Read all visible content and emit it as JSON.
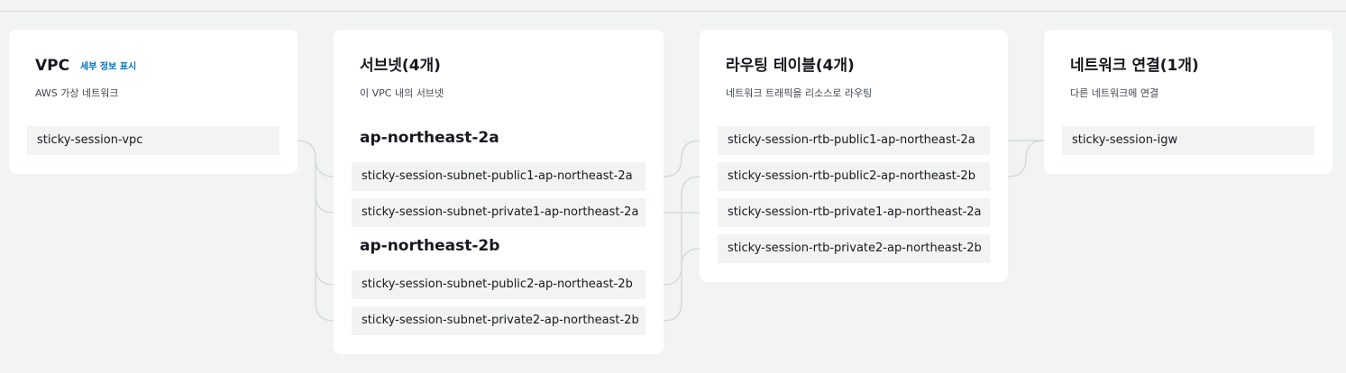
{
  "vpc": {
    "title": "VPC",
    "detail_link": "세부 정보 표시",
    "description": "AWS 가상 네트워크",
    "items": [
      "sticky-session-vpc"
    ]
  },
  "subnets": {
    "title": "서브넷(4개)",
    "description": "이 VPC 내의 서브넷",
    "zones": [
      {
        "name": "ap-northeast-2a",
        "items": [
          "sticky-session-subnet-public1-ap-northeast-2a",
          "sticky-session-subnet-private1-ap-northeast-2a"
        ]
      },
      {
        "name": "ap-northeast-2b",
        "items": [
          "sticky-session-subnet-public2-ap-northeast-2b",
          "sticky-session-subnet-private2-ap-northeast-2b"
        ]
      }
    ]
  },
  "route_tables": {
    "title": "라우팅 테이블(4개)",
    "description": "네트워크 트래픽을 리소스로 라우팅",
    "items": [
      "sticky-session-rtb-public1-ap-northeast-2a",
      "sticky-session-rtb-public2-ap-northeast-2b",
      "sticky-session-rtb-private1-ap-northeast-2a",
      "sticky-session-rtb-private2-ap-northeast-2b"
    ]
  },
  "network_connections": {
    "title": "네트워크 연결(1개)",
    "description": "다른 네트워크에 연결",
    "items": [
      "sticky-session-igw"
    ]
  },
  "colors": {
    "background": "#f2f3f3",
    "card": "#ffffff",
    "item": "#f2f3f3",
    "link": "#0073bb",
    "connector": "#d5dbdb"
  }
}
